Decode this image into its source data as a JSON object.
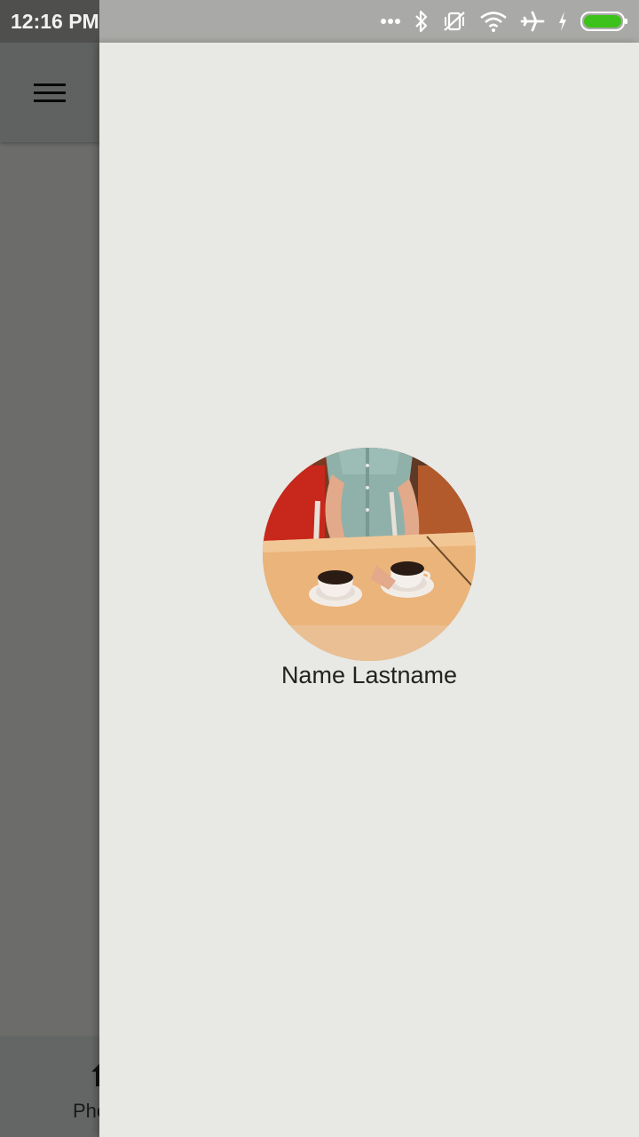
{
  "status_bar": {
    "time": "12:16 PM",
    "icons": [
      "more-dots-icon",
      "bluetooth-icon",
      "vibrate-off-icon",
      "wifi-icon",
      "airplane-icon",
      "charging-icon",
      "battery-icon"
    ],
    "battery_color": "#3cc21a"
  },
  "toolbar": {
    "menu_icon": "hamburger-menu-icon"
  },
  "bottom_nav": {
    "items": [
      {
        "icon": "upload-icon",
        "label": "Photo"
      }
    ]
  },
  "drawer": {
    "profile": {
      "name": "Name Lastname",
      "avatar": "profile-photo"
    }
  }
}
